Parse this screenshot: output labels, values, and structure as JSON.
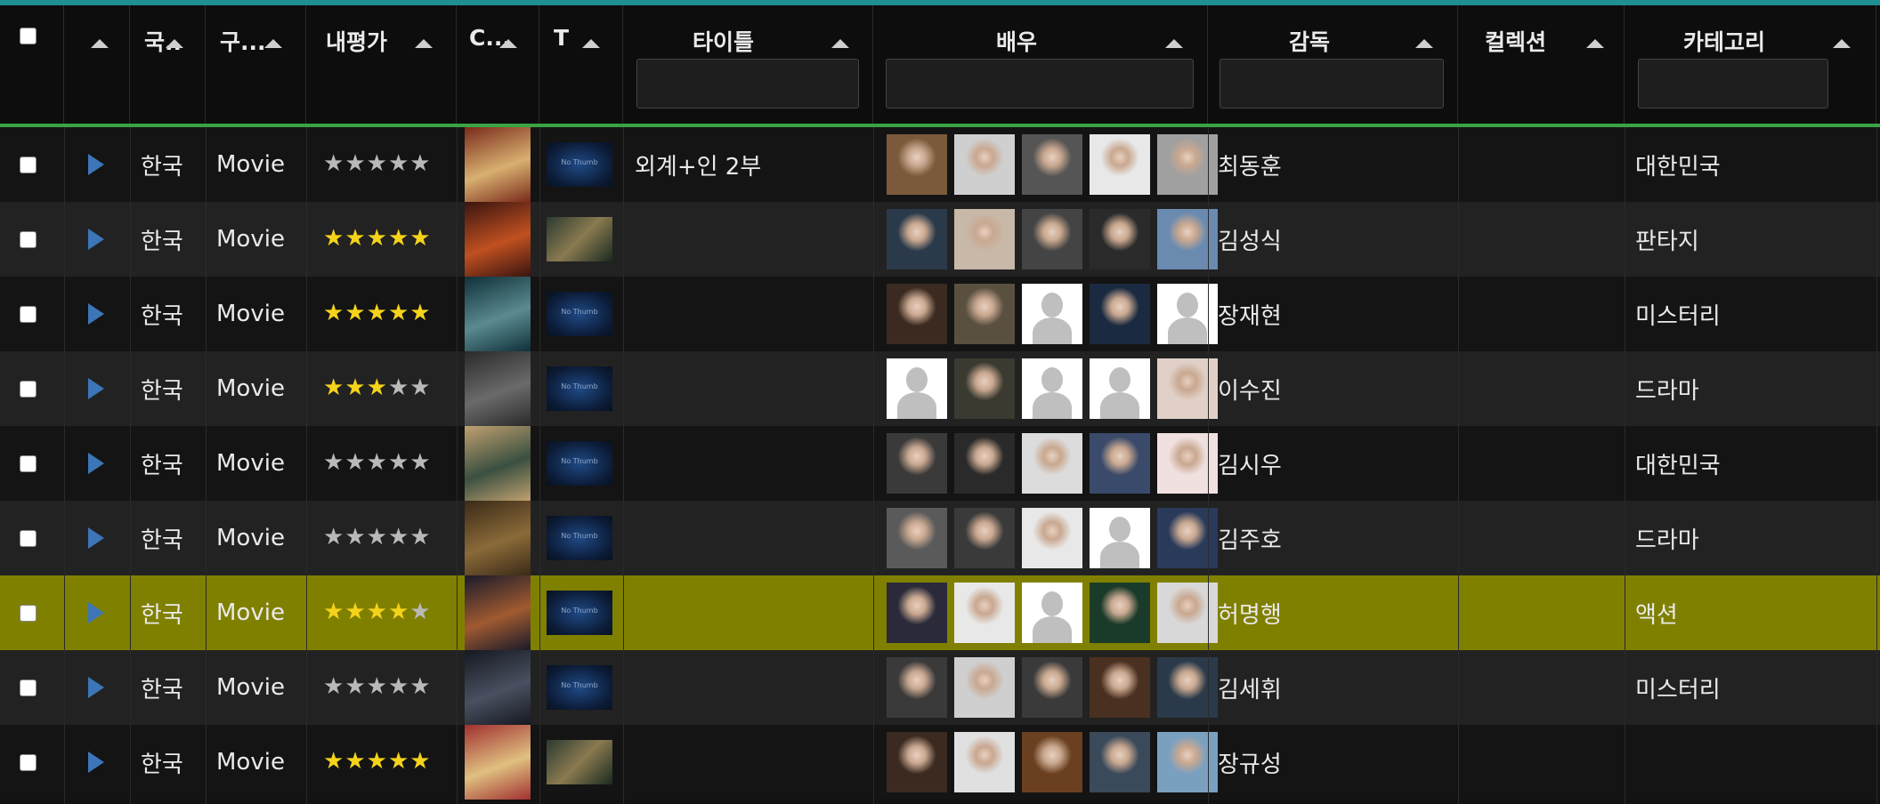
{
  "colors": {
    "header_bg": "#0d0d0d",
    "row_odd": "#141414",
    "row_even": "#222222",
    "row_selected": "#808000",
    "accent_top": "#1f8f93",
    "accent_green": "#3aa445",
    "play_icon": "#3c76b8",
    "star_gold": "#f5d31a",
    "star_grey": "#b9b9b9"
  },
  "header": {
    "country": "국..",
    "type": "구...",
    "rating": "내평가",
    "cover": "C...",
    "thumb": "T",
    "title": "타이틀",
    "actors": "배우",
    "director": "감독",
    "collection": "컬렉션",
    "category": "카테고리"
  },
  "filters": {
    "title_placeholder": "",
    "actors_placeholder": "",
    "director_placeholder": "",
    "category_placeholder": ""
  },
  "rows": [
    {
      "country": "한국",
      "type": "Movie",
      "rating": 0,
      "title": "외계+인 2부",
      "director": "최동훈",
      "collection": "",
      "category": "대한민국",
      "thumb": "none",
      "poster": [
        "#7a2a1a",
        "#d8b070"
      ],
      "actors": [
        "photo:#7a5a3a",
        "photo:#cfcfcf",
        "photo:#555555",
        "photo:#e8e8e8",
        "photo:#a0a0a0"
      ]
    },
    {
      "country": "한국",
      "type": "Movie",
      "rating": 5,
      "title": "",
      "director": "김성식",
      "collection": "",
      "category": "판타지",
      "thumb": "image",
      "poster": [
        "#3a1410",
        "#c05020"
      ],
      "actors": [
        "photo:#2a3a4a",
        "photo:#c8b8a8",
        "photo:#444444",
        "photo:#2a2a2a",
        "photo:#6a8ab0"
      ]
    },
    {
      "country": "한국",
      "type": "Movie",
      "rating": 5,
      "title": "",
      "director": "장재현",
      "collection": "",
      "category": "미스터리",
      "thumb": "none",
      "poster": [
        "#103038",
        "#5a8a90"
      ],
      "actors": [
        "photo:#3a2a20",
        "photo:#5a5040",
        "silhouette",
        "photo:#1a2a40",
        "silhouette"
      ]
    },
    {
      "country": "한국",
      "type": "Movie",
      "rating": 3,
      "title": "",
      "director": "이수진",
      "collection": "",
      "category": "드라마",
      "thumb": "none",
      "poster": [
        "#2a2a2a",
        "#6a6a6a"
      ],
      "actors": [
        "silhouette",
        "photo:#3a3a30",
        "silhouette",
        "silhouette",
        "photo:#e0d0c8"
      ]
    },
    {
      "country": "한국",
      "type": "Movie",
      "rating": 0,
      "title": "",
      "director": "김시우",
      "collection": "",
      "category": "대한민국",
      "thumb": "none",
      "poster": [
        "#c0a070",
        "#3a5040"
      ],
      "actors": [
        "photo:#3a3a3a",
        "photo:#2a2a2a",
        "photo:#dcdcdc",
        "photo:#3a4a6a",
        "photo:#f0e0e0"
      ]
    },
    {
      "country": "한국",
      "type": "Movie",
      "rating": 0,
      "title": "",
      "director": "김주호",
      "collection": "",
      "category": "드라마",
      "thumb": "none",
      "poster": [
        "#3a2a18",
        "#8a6a38"
      ],
      "actors": [
        "photo:#5a5a5a",
        "photo:#3a3a3a",
        "photo:#e8e8e8",
        "silhouette",
        "photo:#2a3a5a"
      ]
    },
    {
      "country": "한국",
      "type": "Movie",
      "rating": 4,
      "title": "",
      "director": "허명행",
      "collection": "",
      "category": "액션",
      "thumb": "none",
      "selected": true,
      "poster": [
        "#1a1a2a",
        "#a05a30"
      ],
      "actors": [
        "photo:#2a2a3a",
        "photo:#e8e8e8",
        "silhouette",
        "photo:#1a3a2a",
        "photo:#d8d8d8"
      ]
    },
    {
      "country": "한국",
      "type": "Movie",
      "rating": 0,
      "title": "",
      "director": "김세휘",
      "collection": "",
      "category": "미스터리",
      "thumb": "none",
      "poster": [
        "#141820",
        "#4a5060"
      ],
      "actors": [
        "photo:#3a3a3a",
        "photo:#cfcfcf",
        "photo:#3a3a3a",
        "photo:#4a3020",
        "photo:#2a3a4a"
      ]
    },
    {
      "country": "한국",
      "type": "Movie",
      "rating": 5,
      "title": "",
      "director": "장규성",
      "collection": "",
      "category": "",
      "thumb": "image",
      "poster": [
        "#a03030",
        "#e0c080"
      ],
      "actors": [
        "photo:#3a2a20",
        "photo:#e0e0e0",
        "photo:#6a4020",
        "photo:#3a4a5a",
        "photo:#7aa0c0"
      ]
    }
  ]
}
